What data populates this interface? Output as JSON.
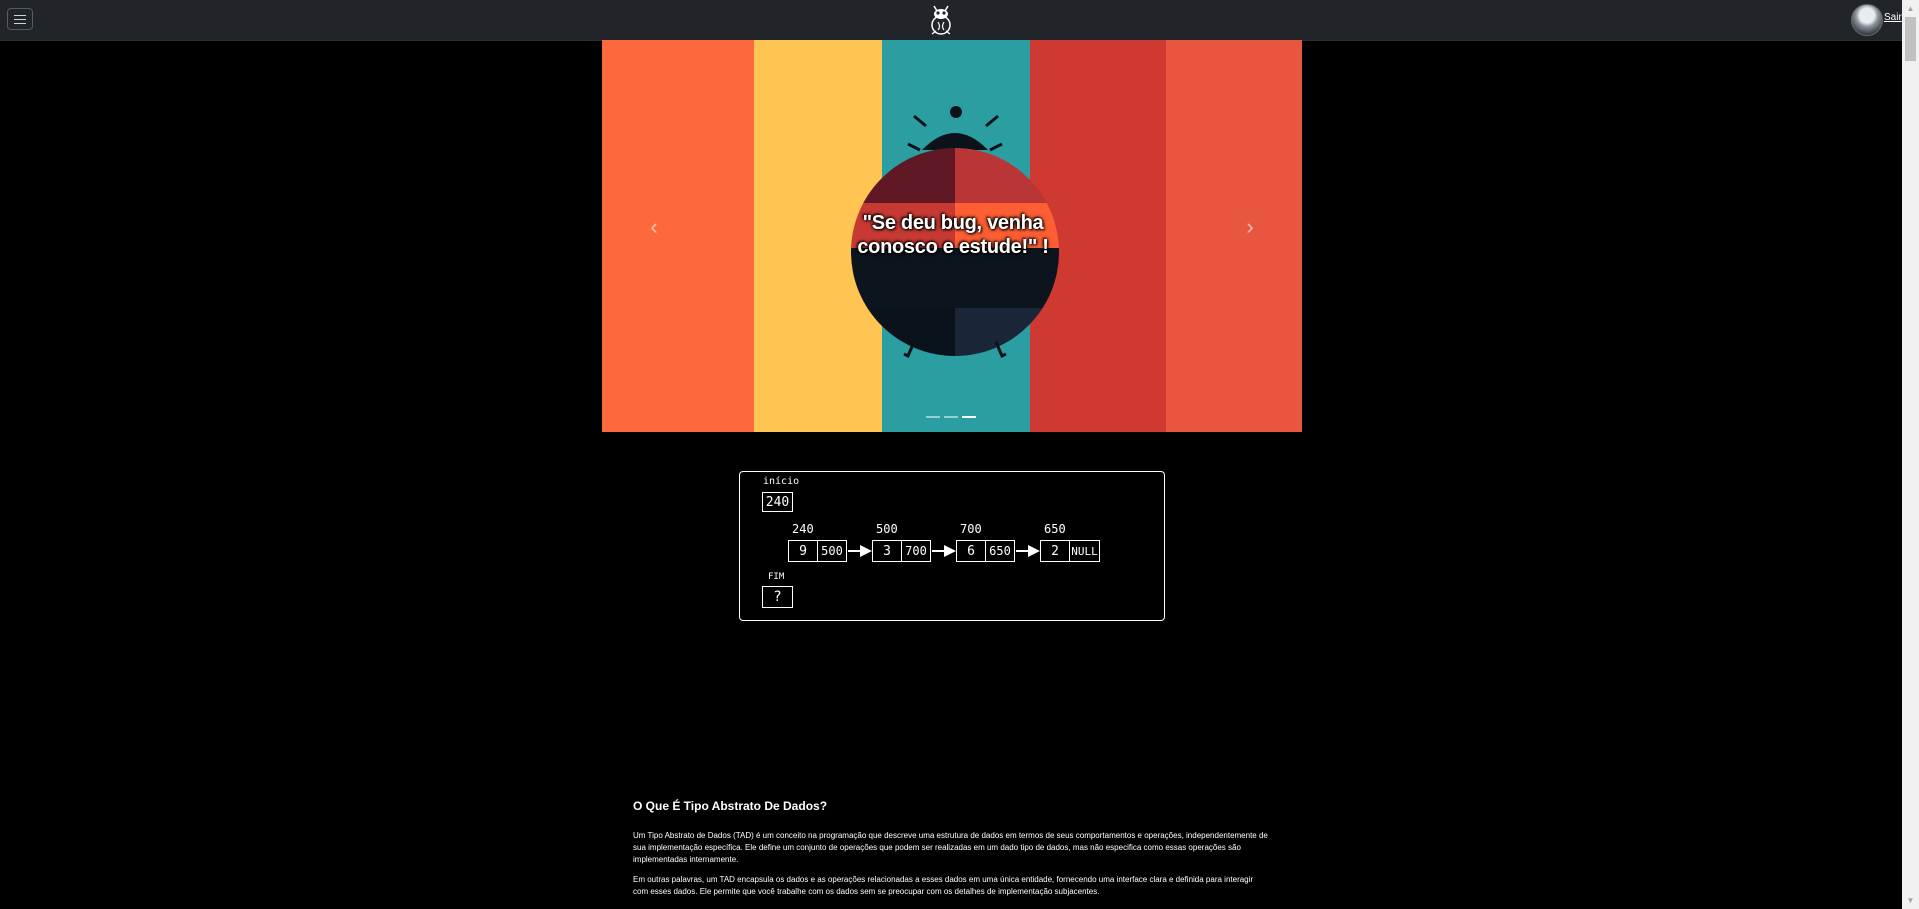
{
  "header": {
    "logout_label": "Sair"
  },
  "carousel": {
    "caption": "\"Se deu bug, venha conosco e estude!\" !",
    "slide_count": 3,
    "active_slide": 3,
    "prev_icon": "chevron-left-icon",
    "next_icon": "chevron-right-icon"
  },
  "diagram": {
    "start_label": "início",
    "start_value": "240",
    "end_label": "FIM",
    "end_value": "?",
    "nodes": [
      {
        "address": "240",
        "value": "9",
        "next": "500"
      },
      {
        "address": "500",
        "value": "3",
        "next": "700"
      },
      {
        "address": "700",
        "value": "6",
        "next": "650"
      },
      {
        "address": "650",
        "value": "2",
        "next": "NULL"
      }
    ]
  },
  "article": {
    "heading": "O Que É Tipo Abstrato De Dados?",
    "paragraphs": [
      "Um Tipo Abstrato de Dados (TAD) é um conceito na programação que descreve uma estrutura de dados em termos de seus comportamentos e operações, independentemente de sua implementação específica. Ele define um conjunto de operações que podem ser realizadas em um dado tipo de dados, mas não especifica como essas operações são implementadas internamente.",
      "Em outras palavras, um TAD encapsula os dados e as operações relacionadas a esses dados em uma única entidade, fornecendo uma interface clara e definida para interagir com esses dados. Ele permite que você trabalhe com os dados sem se preocupar com os detalhes de implementação subjacentes."
    ]
  }
}
